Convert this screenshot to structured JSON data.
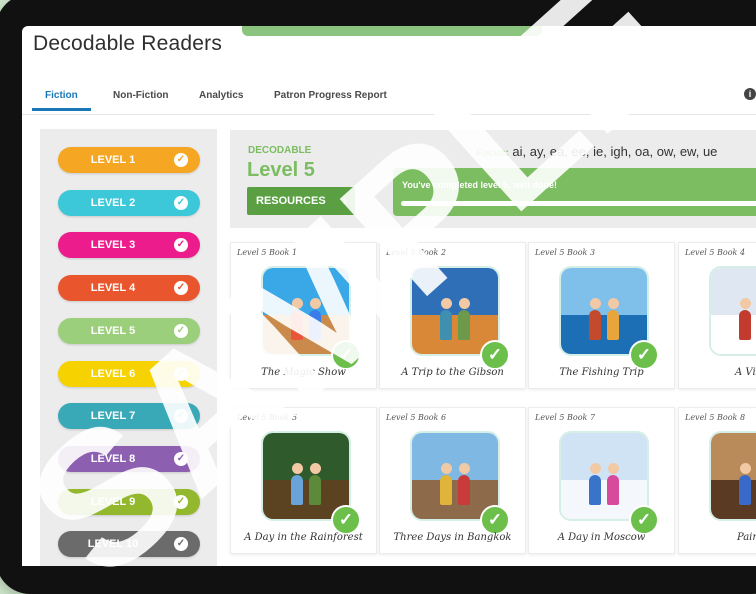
{
  "app": {
    "title": "Decodable Readers"
  },
  "tabs": [
    {
      "label": "Fiction",
      "active": true
    },
    {
      "label": "Non-Fiction",
      "active": false
    },
    {
      "label": "Analytics",
      "active": false
    },
    {
      "label": "Patron Progress Report",
      "active": false
    }
  ],
  "info_icon": {
    "glyph": "i",
    "icon": "info-icon"
  },
  "levels": [
    {
      "label": "LEVEL 1",
      "color": "#f5a623",
      "check_color": "#f5a623"
    },
    {
      "label": "LEVEL 2",
      "color": "#3cc8d8",
      "check_color": "#3cc8d8"
    },
    {
      "label": "LEVEL 3",
      "color": "#ec1c8c",
      "check_color": "#ec1c8c"
    },
    {
      "label": "LEVEL 4",
      "color": "#e9562e",
      "check_color": "#e9562e"
    },
    {
      "label": "LEVEL 5",
      "color": "#9bcf7c",
      "check_color": "#9bcf7c"
    },
    {
      "label": "LEVEL 6",
      "color": "#f5d200",
      "check_color": "#f5d200"
    },
    {
      "label": "LEVEL 7",
      "color": "#39a9b8",
      "check_color": "#39a9b8"
    },
    {
      "label": "LEVEL 8",
      "color": "#8c5fb0",
      "check_color": "#8c5fb0"
    },
    {
      "label": "LEVEL 9",
      "color": "#93b82e",
      "check_color": "#93b82e"
    },
    {
      "label": "LEVEL 10",
      "color": "#6b6b6b",
      "check_color": "#6b6b6b"
    }
  ],
  "level_header": {
    "eyebrow": "DECODABLE",
    "title": "Level 5",
    "resources_label": "RESOURCES",
    "resources_arrow": "›",
    "focus_label": "Focus:",
    "focus_value": "ai, ay, ea, ee, ie, igh, oa, ow, ew, ue",
    "completion_message": "You've completed level 5, well done!",
    "progress_percent": 100
  },
  "books": [
    {
      "number": "Level 5 Book 1",
      "title": "The Magic Show",
      "completed": true,
      "scene": {
        "sky": "#3aa7e6",
        "ground": "#c98a4b",
        "kid1": "#e8553b",
        "kid2": "#3b7de8"
      }
    },
    {
      "number": "Level 5 Book 2",
      "title": "A Trip to the Gibson",
      "completed": true,
      "scene": {
        "sky": "#2f6fb8",
        "ground": "#d98838",
        "kid1": "#3e8fb0",
        "kid2": "#6c9a4a"
      }
    },
    {
      "number": "Level 5 Book 3",
      "title": "The Fishing Trip",
      "completed": true,
      "scene": {
        "sky": "#7fc0ea",
        "ground": "#1c6fb5",
        "kid1": "#c34a2c",
        "kid2": "#e8a53b"
      }
    },
    {
      "number": "Level 5 Book 4",
      "title": "A Visit",
      "completed": true,
      "scene": {
        "sky": "#dfe8f2",
        "ground": "#ffffff",
        "kid1": "#c23b2e",
        "kid2": "#2e5c8c"
      }
    },
    {
      "number": "Level 5 Book 5",
      "title": "A Day in the Rainforest",
      "completed": true,
      "scene": {
        "sky": "#2f5a2b",
        "ground": "#5b4322",
        "kid1": "#6aa3d8",
        "kid2": "#5d8a3a"
      }
    },
    {
      "number": "Level 5 Book 6",
      "title": "Three Days in Bangkok",
      "completed": true,
      "scene": {
        "sky": "#7fb8e2",
        "ground": "#8c6a4a",
        "kid1": "#e0b43a",
        "kid2": "#c93a3a"
      }
    },
    {
      "number": "Level 5 Book 7",
      "title": "A Day in Moscow",
      "completed": true,
      "scene": {
        "sky": "#cfe3f4",
        "ground": "#f4f7fb",
        "kid1": "#3a74c9",
        "kid2": "#d84a9c"
      }
    },
    {
      "number": "Level 5 Book 8",
      "title": "Painti",
      "completed": true,
      "scene": {
        "sky": "#b98a5a",
        "ground": "#5a3a22",
        "kid1": "#3a6ac9",
        "kid2": "#c9a03a"
      }
    }
  ],
  "check_glyph": "✓",
  "watermark": {
    "text": "SAMPLE",
    "color": "#ffffff"
  }
}
